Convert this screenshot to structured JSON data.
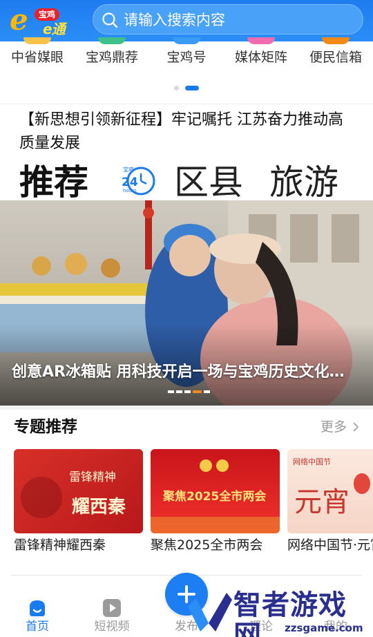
{
  "header": {
    "logo_badge": "宝鸡",
    "logo_letter": "e",
    "logo_text": "e通",
    "search_placeholder": "请输入搜索内容",
    "search_icon": "search-icon"
  },
  "channels": [
    "中省媒眼",
    "宝鸡鼎荐",
    "宝鸡号",
    "媒体矩阵",
    "便民信箱"
  ],
  "banner_pager": {
    "count": 2,
    "active_index": 1
  },
  "headline": "【新思想引领新征程】牢记嘱托 江苏奋力推动高质量发展",
  "tabs": {
    "items": [
      "推荐",
      "区县",
      "旅游"
    ],
    "active": "推荐",
    "icon_badge_top": "宝鸡",
    "icon_badge_num": "24",
    "icon_badge_sub": "hours"
  },
  "hero": {
    "caption": "创意AR冰箱贴 用科技开启一场与宝鸡历史文化…",
    "pager": {
      "count": 5,
      "active_index": 3
    }
  },
  "special": {
    "title": "专题推荐",
    "more": "更多",
    "cards": [
      {
        "label": "雷锋精神耀西秦",
        "thumb_text_1": "雷锋精神",
        "thumb_text_2": "耀西秦"
      },
      {
        "label": "聚焦2025全市两会",
        "thumb_text_1": "聚焦2025全市两会"
      },
      {
        "label": "网络中国节·元宵",
        "thumb_text_1": "网络中国节",
        "thumb_text_2": "元宵"
      }
    ]
  },
  "nav": {
    "items": [
      {
        "label": "首页",
        "icon": "home-icon",
        "active": true
      },
      {
        "label": "短视频",
        "icon": "video-icon",
        "active": false
      },
      {
        "label": "发布",
        "icon": "plus-icon",
        "active": false
      },
      {
        "label": "理论",
        "icon": "book-icon",
        "active": false
      },
      {
        "label": "我的",
        "icon": "user-icon",
        "active": false
      }
    ]
  },
  "watermark": {
    "text": "智者游戏网",
    "url": "zzsgame.com"
  },
  "colors": {
    "brand_blue": "#1f7cf0",
    "accent_red": "#e8222b",
    "accent_orange": "#f28a1a"
  }
}
